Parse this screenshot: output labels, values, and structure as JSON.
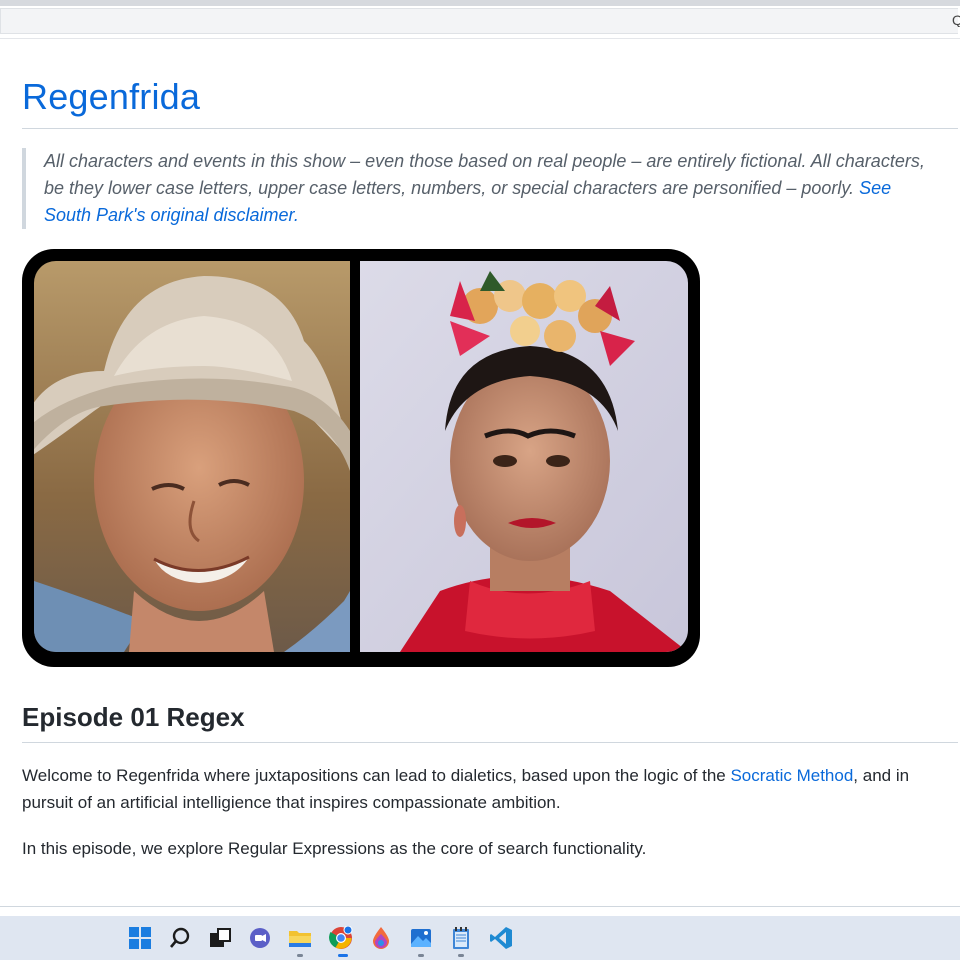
{
  "page": {
    "title": "Regenfrida"
  },
  "disclaimer": {
    "text": "All characters and events in this show – even those based on real people – are entirely fictional. All characters, be they lower case letters, upper case letters, numbers, or special characters are personified – poorly. ",
    "link_text": "See South Park's original disclaimer."
  },
  "episode": {
    "title": "Episode 01 Regex",
    "para1_before": "Welcome to Regenfrida where juxtapositions can lead to dialetics, based upon the logic of the ",
    "para1_link": "Socratic Method",
    "para1_after": ", and in pursuit of an artificial intelligience that inspires compassionate ambition.",
    "para2": "In this episode, we explore Regular Expressions as the core of search functionality."
  },
  "addressbar": {
    "hint": "Q"
  },
  "taskbar": {
    "icons": [
      "windows-start-icon",
      "search-icon",
      "task-view-icon",
      "chat-icon",
      "file-explorer-icon",
      "chrome-icon",
      "paint-icon",
      "photos-icon",
      "notepad-icon",
      "vscode-icon"
    ]
  },
  "colors": {
    "link": "#0969da",
    "text": "#24292f",
    "muted": "#57606a",
    "taskbar": "#dfe6f1"
  }
}
